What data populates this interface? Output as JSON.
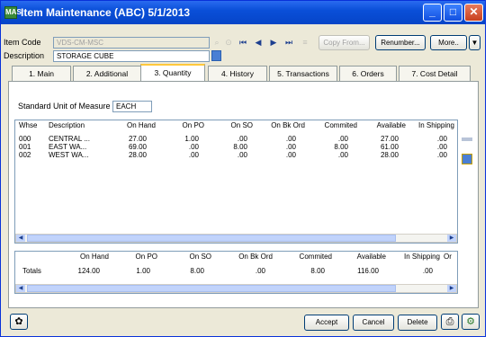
{
  "window": {
    "title": "Item Maintenance (ABC) 5/1/2013",
    "app_icon": "MAS",
    "buttons": {
      "minimize": "_",
      "maximize": "□",
      "close": "✕"
    }
  },
  "header": {
    "item_code_label": "Item Code",
    "item_code_value": "VDS-CM-MSC",
    "description_label": "Description",
    "description_value": "STORAGE CUBE",
    "copy_from_label": "Copy From...",
    "renumber_label": "Renumber...",
    "more_label": "More..",
    "more_arrow": "▼"
  },
  "tabs": [
    {
      "label": "1. Main"
    },
    {
      "label": "2. Additional"
    },
    {
      "label": "3. Quantity"
    },
    {
      "label": "4. History"
    },
    {
      "label": "5. Transactions"
    },
    {
      "label": "6. Orders"
    },
    {
      "label": "7. Cost Detail"
    }
  ],
  "quantity": {
    "uom_label": "Standard Unit of Measure",
    "uom_value": "EACH",
    "columns": [
      "Whse",
      "Description",
      "On Hand",
      "On PO",
      "On SO",
      "On Bk Ord",
      "Commited",
      "Available",
      "In Shipping"
    ],
    "rows": [
      [
        "000",
        "CENTRAL ...",
        "27.00",
        "1.00",
        ".00",
        ".00",
        ".00",
        "27.00",
        ".00"
      ],
      [
        "001",
        "EAST WA...",
        "69.00",
        ".00",
        "8.00",
        ".00",
        "8.00",
        "61.00",
        ".00"
      ],
      [
        "002",
        "WEST WA...",
        "28.00",
        ".00",
        ".00",
        ".00",
        ".00",
        "28.00",
        ".00"
      ]
    ],
    "totals_columns": [
      "On Hand",
      "On PO",
      "On SO",
      "On Bk Ord",
      "Commited",
      "Available",
      "In Shipping",
      "Or"
    ],
    "totals_label": "Totals",
    "totals_values": [
      "124.00",
      "1.00",
      "8.00",
      ".00",
      "8.00",
      "116.00",
      ".00"
    ]
  },
  "footer": {
    "accept_label": "Accept",
    "cancel_label": "Cancel",
    "delete_label": "Delete"
  }
}
